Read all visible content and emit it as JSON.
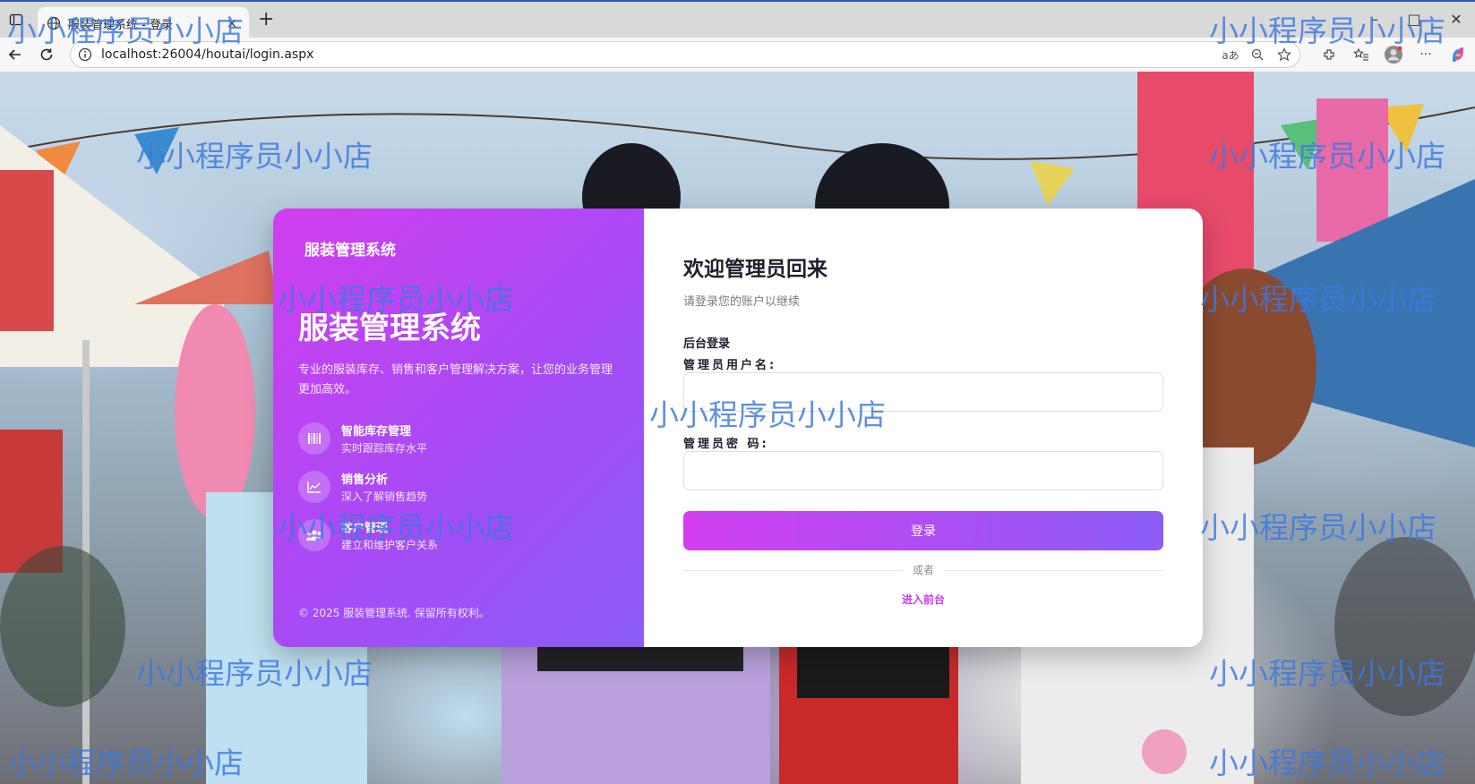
{
  "browser": {
    "tab_title": "服装管理系统 - 登录",
    "tab_close": "×",
    "new_tab": "+",
    "url": "localhost:26004/houtai/login.aspx",
    "window_controls": {
      "minimize": "–",
      "maximize": "□",
      "close": "✕"
    },
    "more_label": "···"
  },
  "login_card": {
    "left": {
      "brand_small": "服装管理系统",
      "brand_big": "服装管理系统",
      "description": "专业的服装库存、销售和客户管理解决方案，让您的业务管理更加高效。",
      "features": [
        {
          "icon": "barcode-icon",
          "title": "智能库存管理",
          "subtitle": "实时跟踪库存水平"
        },
        {
          "icon": "chart-icon",
          "title": "销售分析",
          "subtitle": "深入了解销售趋势"
        },
        {
          "icon": "users-icon",
          "title": "客户管理",
          "subtitle": "建立和维护客户关系"
        }
      ],
      "copyright": "© 2025 服装管理系统. 保留所有权利。"
    },
    "right": {
      "welcome": "欢迎管理员回来",
      "subtitle": "请登录您的账户以继续",
      "section_title": "后台登录",
      "username_label": "管理员用户名:",
      "username_value": "",
      "password_label": "管理员密 码:",
      "password_value": "",
      "login_button": "登录",
      "or_text": "或者",
      "front_link": "进入前台"
    },
    "colors": {
      "gradient_start": "#d13ef0",
      "gradient_end": "#8b5cf6",
      "link": "#c83ce8"
    }
  },
  "watermark": "小小程序员小小店"
}
